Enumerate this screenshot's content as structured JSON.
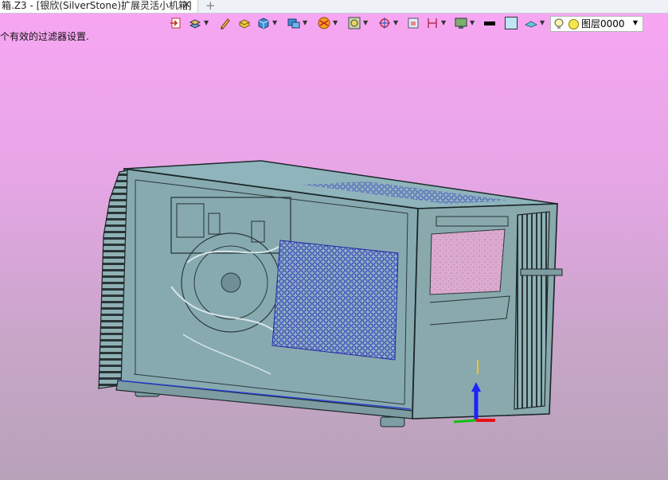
{
  "tab": {
    "title": "箱.Z3 - [银欣(SilverStone)扩展灵活小机箱]",
    "close": "✕",
    "new": "+"
  },
  "status_text": "个有效的过滤器设置.",
  "layer": {
    "name": "图层0000",
    "arrow": "▼"
  },
  "colors": {
    "viewport_top": "#f7a6f2",
    "viewport_bottom": "#b8a2ba",
    "model_glass": "#8fb3b8",
    "perforation": "#2e33b8",
    "pink_mesh": "#f1a8dc"
  },
  "icons": [
    "exit-icon",
    "layers-icon",
    "pencil-icon",
    "shade-icon",
    "cube-icon",
    "display-icon",
    "filter-icon",
    "snap-icon",
    "pick-icon",
    "frame-icon",
    "dimension-icon",
    "view-icon",
    "color-swatch",
    "box-swatch",
    "shape-icon",
    "bulb-icon"
  ]
}
